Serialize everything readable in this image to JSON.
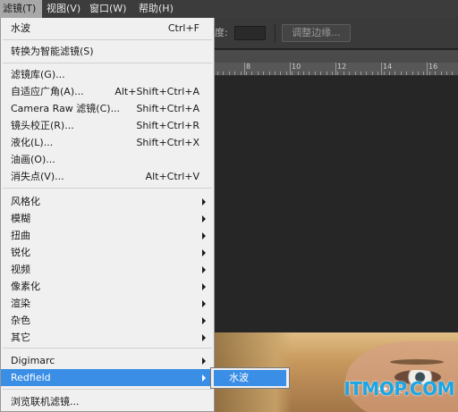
{
  "menubar": {
    "filter": "滤镜(T)",
    "view": "视图(V)",
    "window": "窗口(W)",
    "help": "帮助(H)"
  },
  "options_bar": {
    "density_label": "度:",
    "refine_edge": "调整边缘..."
  },
  "ruler": {
    "labels": [
      "8",
      "10",
      "12",
      "14",
      "16"
    ]
  },
  "filter_menu": {
    "last_filter": {
      "label": "水波",
      "shortcut": "Ctrl+F"
    },
    "convert_smart": {
      "label": "转换为智能滤镜(S)"
    },
    "filter_gallery": {
      "label": "滤镜库(G)..."
    },
    "adaptive_wide_angle": {
      "label": "自适应广角(A)...",
      "shortcut": "Alt+Shift+Ctrl+A"
    },
    "camera_raw": {
      "label": "Camera Raw 滤镜(C)...",
      "shortcut": "Shift+Ctrl+A"
    },
    "lens_correction": {
      "label": "镜头校正(R)...",
      "shortcut": "Shift+Ctrl+R"
    },
    "liquify": {
      "label": "液化(L)...",
      "shortcut": "Shift+Ctrl+X"
    },
    "oil_paint": {
      "label": "油画(O)..."
    },
    "vanishing_point": {
      "label": "消失点(V)...",
      "shortcut": "Alt+Ctrl+V"
    },
    "stylize": {
      "label": "风格化"
    },
    "blur": {
      "label": "模糊"
    },
    "distort": {
      "label": "扭曲"
    },
    "sharpen": {
      "label": "锐化"
    },
    "video": {
      "label": "视频"
    },
    "pixelate": {
      "label": "像素化"
    },
    "render": {
      "label": "渲染"
    },
    "noise": {
      "label": "杂色"
    },
    "other": {
      "label": "其它"
    },
    "digimarc": {
      "label": "Digimarc"
    },
    "redfield": {
      "label": "Redfield"
    },
    "browse_online": {
      "label": "浏览联机滤镜..."
    }
  },
  "redfield_submenu": {
    "item": "水波"
  },
  "watermark": "ITMOP.COM",
  "colors": {
    "highlight": "#3a8ee6",
    "menu_bg": "#f0f0f0",
    "workspace_bg": "#262626",
    "watermark": "#1aa6e6"
  }
}
